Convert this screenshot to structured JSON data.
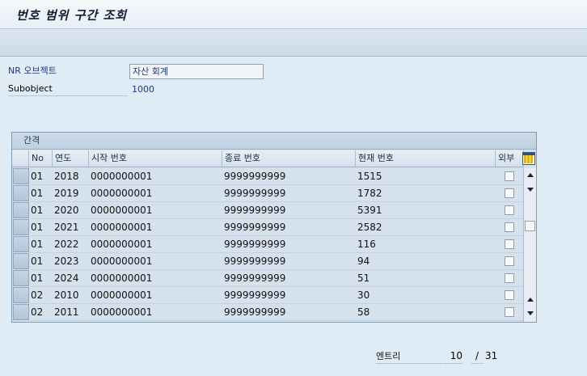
{
  "window": {
    "title": "번호 범위 구간 조회"
  },
  "form": {
    "nr_object_label": "NR 오브젝트",
    "nr_object_value": "자산 회계",
    "subobject_label": "Subobject",
    "subobject_value": "1000"
  },
  "grid": {
    "title": "간격",
    "columns": [
      "No",
      "연도",
      "시작 번호",
      "종료 번호",
      "현재 번호",
      "외부"
    ],
    "rows": [
      {
        "no": "01",
        "year": "2018",
        "from": "0000000001",
        "to": "9999999999",
        "current": "1515",
        "external": false
      },
      {
        "no": "01",
        "year": "2019",
        "from": "0000000001",
        "to": "9999999999",
        "current": "1782",
        "external": false
      },
      {
        "no": "01",
        "year": "2020",
        "from": "0000000001",
        "to": "9999999999",
        "current": "5391",
        "external": false
      },
      {
        "no": "01",
        "year": "2021",
        "from": "0000000001",
        "to": "9999999999",
        "current": "2582",
        "external": false
      },
      {
        "no": "01",
        "year": "2022",
        "from": "0000000001",
        "to": "9999999999",
        "current": "116",
        "external": false
      },
      {
        "no": "01",
        "year": "2023",
        "from": "0000000001",
        "to": "9999999999",
        "current": "94",
        "external": false
      },
      {
        "no": "01",
        "year": "2024",
        "from": "0000000001",
        "to": "9999999999",
        "current": "51",
        "external": false
      },
      {
        "no": "02",
        "year": "2010",
        "from": "0000000001",
        "to": "9999999999",
        "current": "30",
        "external": false
      },
      {
        "no": "02",
        "year": "2011",
        "from": "0000000001",
        "to": "9999999999",
        "current": "58",
        "external": false
      }
    ]
  },
  "footer": {
    "entries_label": "엔트리",
    "current_entry": "10",
    "separator": "/",
    "total_entries": "31"
  },
  "icons": {
    "settings": "table-settings-icon",
    "scroll_up": "scroll-up-icon",
    "scroll_down": "scroll-down-icon"
  }
}
